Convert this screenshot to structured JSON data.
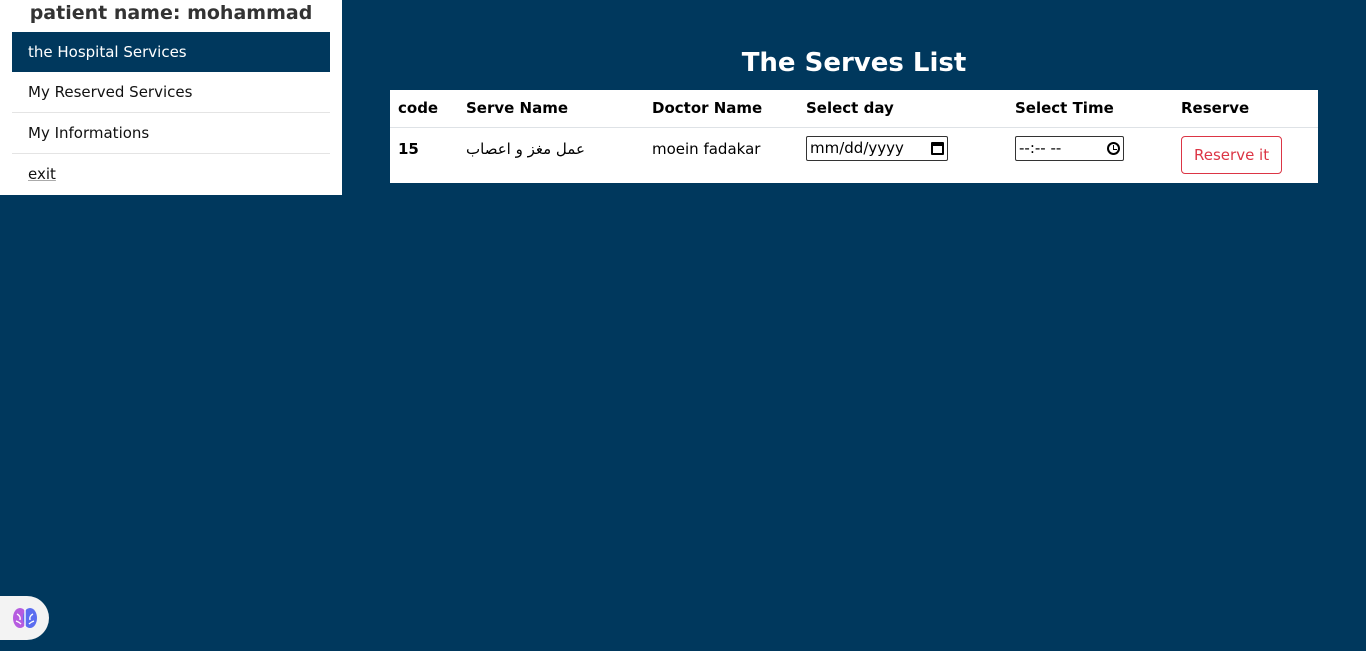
{
  "sidebar": {
    "patient_name": "patient name: mohammad",
    "items": [
      {
        "label": "the Hospital Services",
        "active": true
      },
      {
        "label": "My Reserved Services",
        "active": false
      },
      {
        "label": "My Informations",
        "active": false
      },
      {
        "label": "exit",
        "active": false
      }
    ]
  },
  "main": {
    "title": "The Serves List",
    "columns": [
      "code",
      "Serve Name",
      "Doctor Name",
      "Select day",
      "Select Time",
      "Reserve"
    ],
    "rows": [
      {
        "code": "15",
        "serve_name": "عمل مغز و اعصاب",
        "doctor": "moein fadakar",
        "date_placeholder": "mm/dd/yyyy",
        "time_placeholder": "--:-- --",
        "reserve_label": "Reserve it"
      }
    ]
  },
  "colors": {
    "primary": "#00385d",
    "danger": "#dc3545"
  },
  "icons": [
    "calendar-icon",
    "clock-icon",
    "brain-icon"
  ]
}
